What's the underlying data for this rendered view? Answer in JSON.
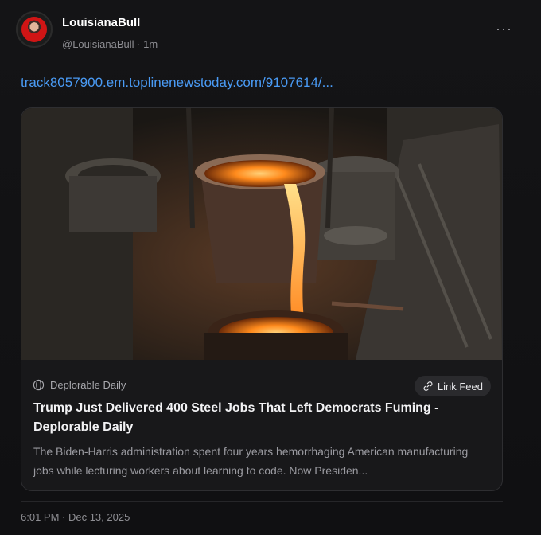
{
  "author": {
    "display_name": "LouisianaBull",
    "handle": "@LouisianaBull",
    "separator": "·",
    "time_ago": "1m"
  },
  "menu_icon": "more-horizontal-icon",
  "post": {
    "link_text": "track8057900.em.toplinenewstoday.com/9107614/..."
  },
  "card": {
    "image_icon": "molten-steel-photo",
    "source_icon": "globe-icon",
    "source": "Deplorable Daily",
    "feed_button": "Link Feed",
    "feed_button_icon": "link-icon",
    "title": "Trump Just Delivered 400 Steel Jobs That Left Democrats Fuming - Deplorable Daily",
    "description": "The Biden-Harris administration spent four years hemorrhaging American manufacturing jobs while lecturing workers about learning to code. Now Presiden..."
  },
  "timestamp": "6:01 PM · Dec 13, 2025",
  "colors": {
    "background": "#0f0f10",
    "link": "#4a9bf5",
    "card_bg": "#18181a",
    "muted_text": "#8e8e93"
  }
}
